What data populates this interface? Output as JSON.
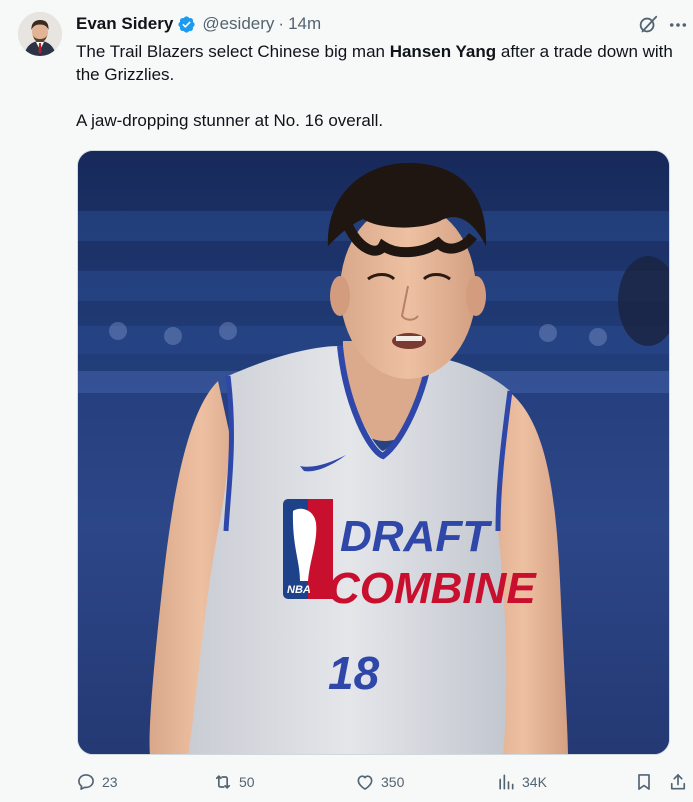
{
  "author": {
    "name": "Evan Sidery",
    "handle": "@esidery",
    "separator": "·",
    "time": "14m",
    "verified_color": "#1d9bf0",
    "avatar_icon": "avatar-photo"
  },
  "tweet": {
    "line1_pre": "The Trail Blazers select Chinese big man ",
    "line1_bold": "Hansen Yang",
    "line1_post": " after a trade down with the Grizzlies.",
    "line2": "A jaw-dropping stunner at No. 16 overall."
  },
  "media": {
    "jersey_line1": "DRAFT",
    "jersey_line2": "COMBINE",
    "jersey_number": "18",
    "jersey_logo": "NBA"
  },
  "actions": {
    "replies": "23",
    "reposts": "50",
    "likes": "350",
    "views": "34K"
  },
  "icons": {
    "reply": "reply-icon",
    "repost": "repost-icon",
    "like": "heart-icon",
    "views": "views-icon",
    "bookmark": "bookmark-icon",
    "share": "share-icon",
    "grok": "grok-icon"
  },
  "colors": {
    "text": "#0f1419",
    "muted": "#536471",
    "accent": "#1d9bf0",
    "background": "#f7f9f9"
  }
}
